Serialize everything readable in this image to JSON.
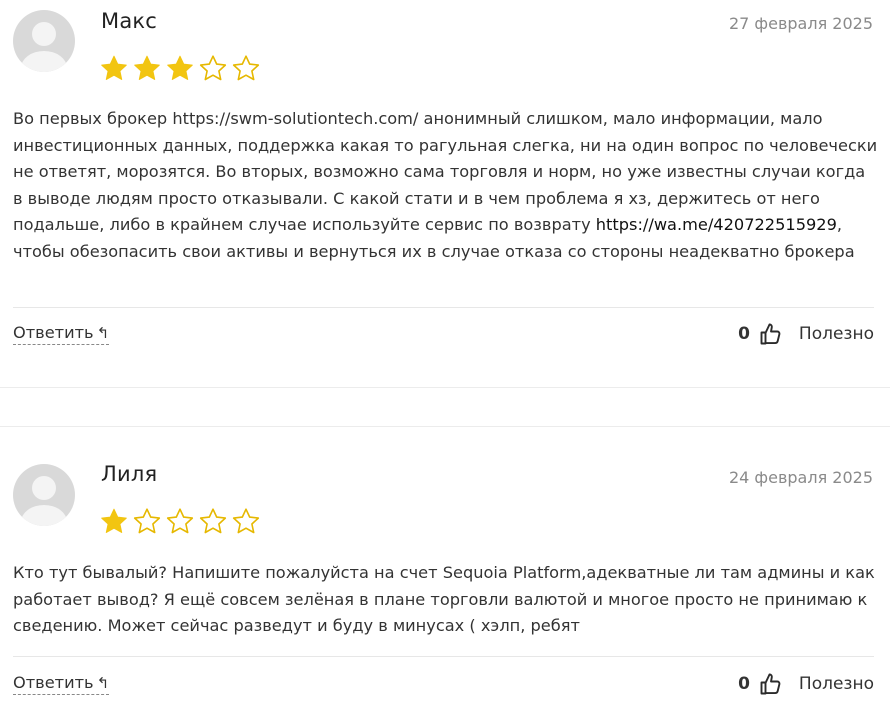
{
  "reviews": [
    {
      "author": "Макс",
      "date": "27 февраля 2025",
      "rating": 3,
      "max_rating": 5,
      "text_before_link": "Во первых брокер https://swm-solutiontech.com/ анонимный слишком, мало информации, мало инвестиционных данных, поддержка какая то рагульная слегка, ни на один вопрос по человечески не ответят, морозятся. Во вторых, возможно сама торговля и норм, но уже известны случаи когда в выводе людям просто отказывали. С какой стати и в чем проблема я хз, держитесь от него подальше, либо в крайнем случае используйте сервис по возврату ",
      "link": "https://wa.me/420722515929",
      "text_after_link": ", чтобы обезопасить свои активы и вернуться их в случае отказа со стороны неадекватно брокера",
      "reply_label": "Ответить",
      "reply_icon": "↰",
      "helpful_count": "0",
      "helpful_label": "Полезно"
    },
    {
      "author": "Лиля",
      "date": "24 февраля 2025",
      "rating": 1,
      "max_rating": 5,
      "text_before_link": "Кто тут бывалый? Напишите пожалуйста на счет Sequoia Platform,адекватные ли там админы и как работает вывод? Я ещё совсем зелёная в плане торговли валютой и многое просто не принимаю к сведению. Может сейчас разведут и буду в минусах ( хэлп, ребят",
      "link": "",
      "text_after_link": "",
      "reply_label": "Ответить",
      "reply_icon": "↰",
      "helpful_count": "0",
      "helpful_label": "Полезно"
    }
  ],
  "colors": {
    "star_filled": "#F2C511",
    "star_empty_stroke": "#E6B800",
    "avatar_bg": "#D9D9D9",
    "avatar_fg": "#F4F4F4"
  },
  "icons": {
    "avatar": "user-silhouette-icon",
    "star": "star-icon",
    "reply": "reply-arrow-icon",
    "helpful": "thumbs-up-icon"
  }
}
